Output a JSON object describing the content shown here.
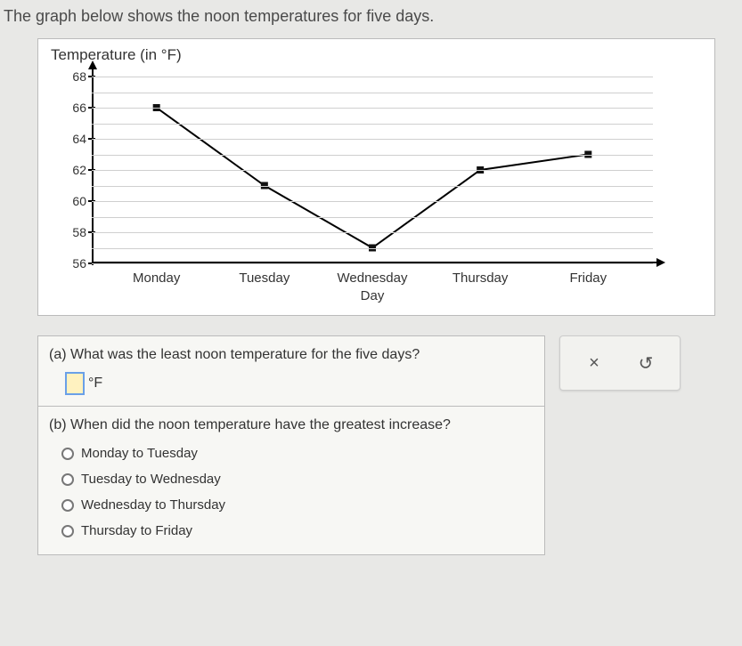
{
  "intro": "The graph below shows the noon temperatures for five days.",
  "chart_data": {
    "type": "line",
    "title": "Temperature (in °F)",
    "xlabel": "Day",
    "ylabel": "",
    "categories": [
      "Monday",
      "Tuesday",
      "Wednesday",
      "Thursday",
      "Friday"
    ],
    "values": [
      66,
      61,
      57,
      62,
      63
    ],
    "ylim": [
      56,
      68
    ],
    "y_ticks": [
      56,
      58,
      60,
      62,
      64,
      66,
      68
    ]
  },
  "questions": {
    "a": {
      "text": "(a) What was the least noon temperature for the five days?",
      "unit": "°F",
      "value": ""
    },
    "b": {
      "text": "(b) When did the noon temperature have the greatest increase?",
      "options": [
        "Monday to Tuesday",
        "Tuesday to Wednesday",
        "Wednesday to Thursday",
        "Thursday to Friday"
      ]
    }
  },
  "controls": {
    "close": "×",
    "reset": "↺"
  }
}
